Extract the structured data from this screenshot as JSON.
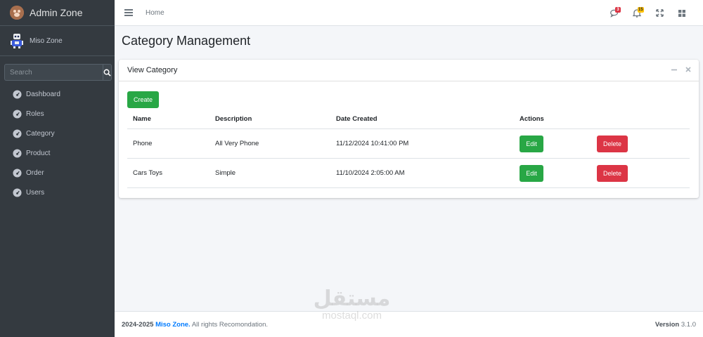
{
  "brand": {
    "name": "Admin Zone"
  },
  "user": {
    "name": "Miso Zone"
  },
  "search": {
    "placeholder": "Search"
  },
  "sidebar": {
    "items": [
      {
        "label": "Dashboard",
        "icon": "gauge-icon"
      },
      {
        "label": "Roles",
        "icon": "gauge-icon"
      },
      {
        "label": "Category",
        "icon": "gauge-icon"
      },
      {
        "label": "Product",
        "icon": "gauge-icon"
      },
      {
        "label": "Order",
        "icon": "gauge-icon"
      },
      {
        "label": "Users",
        "icon": "gauge-icon"
      }
    ]
  },
  "topbar": {
    "home_label": "Home",
    "messages_count": "3",
    "notifications_count": "15"
  },
  "page": {
    "title": "Category Management"
  },
  "card": {
    "title": "View Category",
    "create_label": "Create",
    "columns": [
      "Name",
      "Description",
      "Date Created",
      "Actions"
    ],
    "rows": [
      {
        "name": "Phone",
        "description": "All Very Phone",
        "date": "11/12/2024 10:41:00 PM",
        "edit": "Edit",
        "delete": "Delete"
      },
      {
        "name": "Cars Toys",
        "description": "Simple",
        "date": "11/10/2024 2:05:00 AM",
        "edit": "Edit",
        "delete": "Delete"
      }
    ]
  },
  "footer": {
    "years": "2024-2025",
    "company": "Miso Zone.",
    "rights": "All rights Recomondation.",
    "version_label": "Version",
    "version": "3.1.0"
  },
  "watermark": {
    "arabic": "مستقل",
    "latin": "mostaql.com"
  },
  "colors": {
    "sidebar": "#343a40",
    "success": "#28a745",
    "danger": "#dc3545",
    "primary": "#007bff"
  }
}
